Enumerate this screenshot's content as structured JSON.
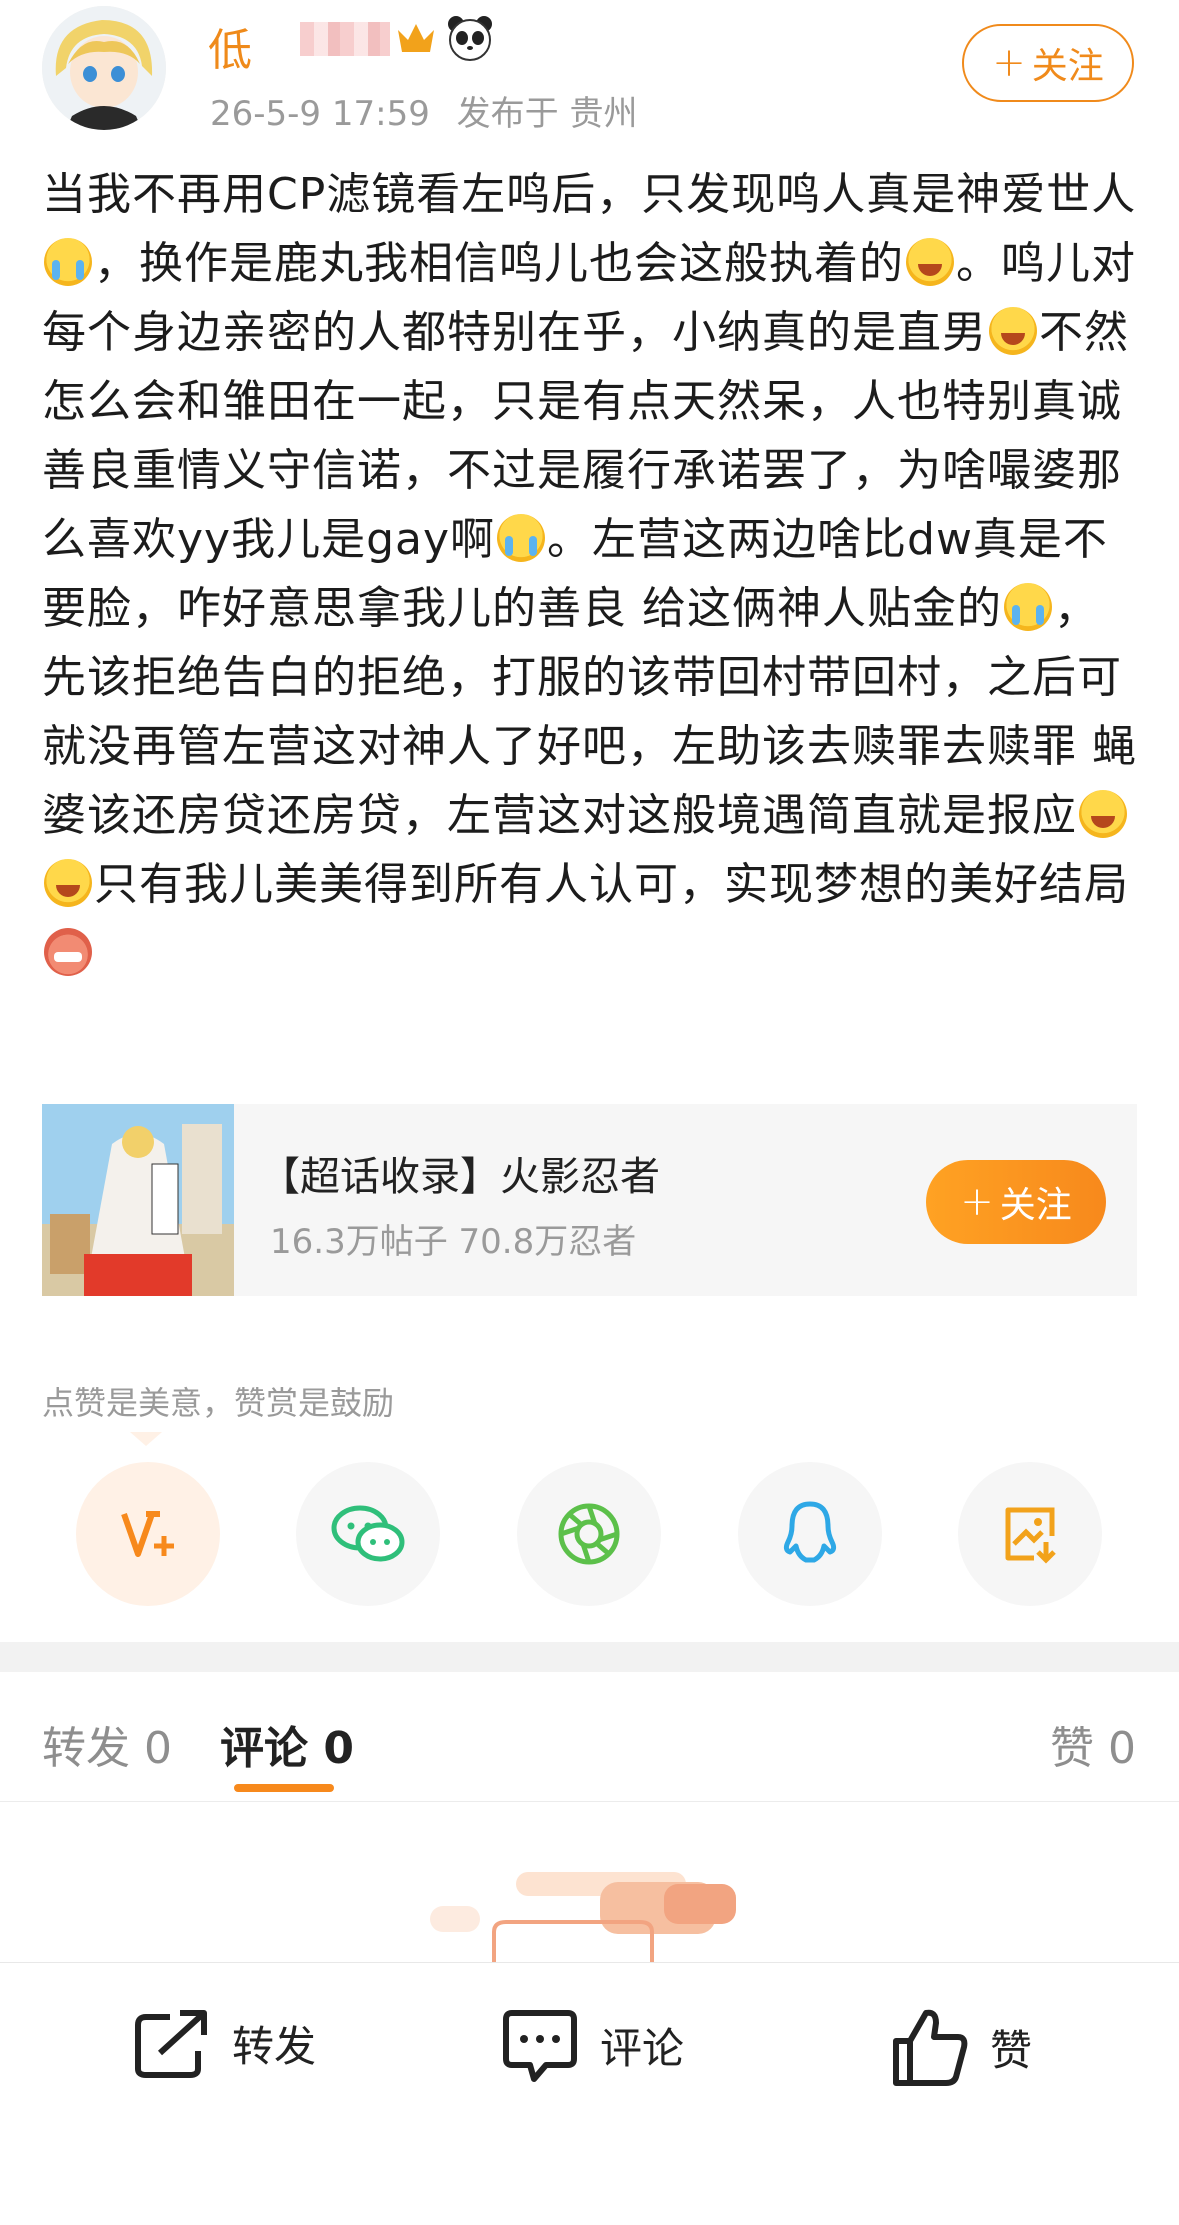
{
  "header": {
    "username": "低",
    "timestamp": "26-5-9 17:59",
    "location": "发布于 贵州",
    "follow_label": "关注",
    "follow_plus": "+"
  },
  "post": {
    "segments": [
      "当我不再用CP滤镜看左鸣后，只发现鸣人真是神爱世人",
      "，换作是鹿丸我相信鸣儿也会这般执着的",
      "。鸣儿对每个身边亲密的人都特别在乎，小纳真的是直男",
      "不然怎么会和雏田在一起，只是有点天然呆，人也特别真诚善良重情义守信诺，不过是履行承诺罢了，为啥嘬婆那么喜欢yy我儿是gay啊",
      "。左营这两边啥比dw真是不要脸，咋好意思拿我儿的善良 给这俩神人贴金的",
      "，先该拒绝告白的拒绝，打服的该带回村带回村，之后可就没再管左营这对神人了好吧，左助该去赎罪去赎罪 蝇婆该还房贷还房贷，左营这对这般境遇简直就是报应",
      "只有我儿美美得到所有人认可，实现梦想的美好结局"
    ]
  },
  "topic": {
    "title": "【超话收录】火影忍者",
    "stats": "16.3万帖子 70.8万忍者",
    "follow_label": "关注",
    "follow_plus": "+"
  },
  "reward_hint": "点赞是美意，赞赏是鼓励",
  "share": {
    "items": [
      "reward-icon",
      "wechat-icon",
      "moments-icon",
      "qq-icon",
      "save-image-icon"
    ]
  },
  "tabs": {
    "repost": "转发 0",
    "comment": "评论 0",
    "like": "赞 0"
  },
  "bottom_bar": {
    "repost": "转发",
    "comment": "评论",
    "like": "赞"
  },
  "colors": {
    "accent": "#f7891c",
    "username": "#ef8a1a"
  }
}
